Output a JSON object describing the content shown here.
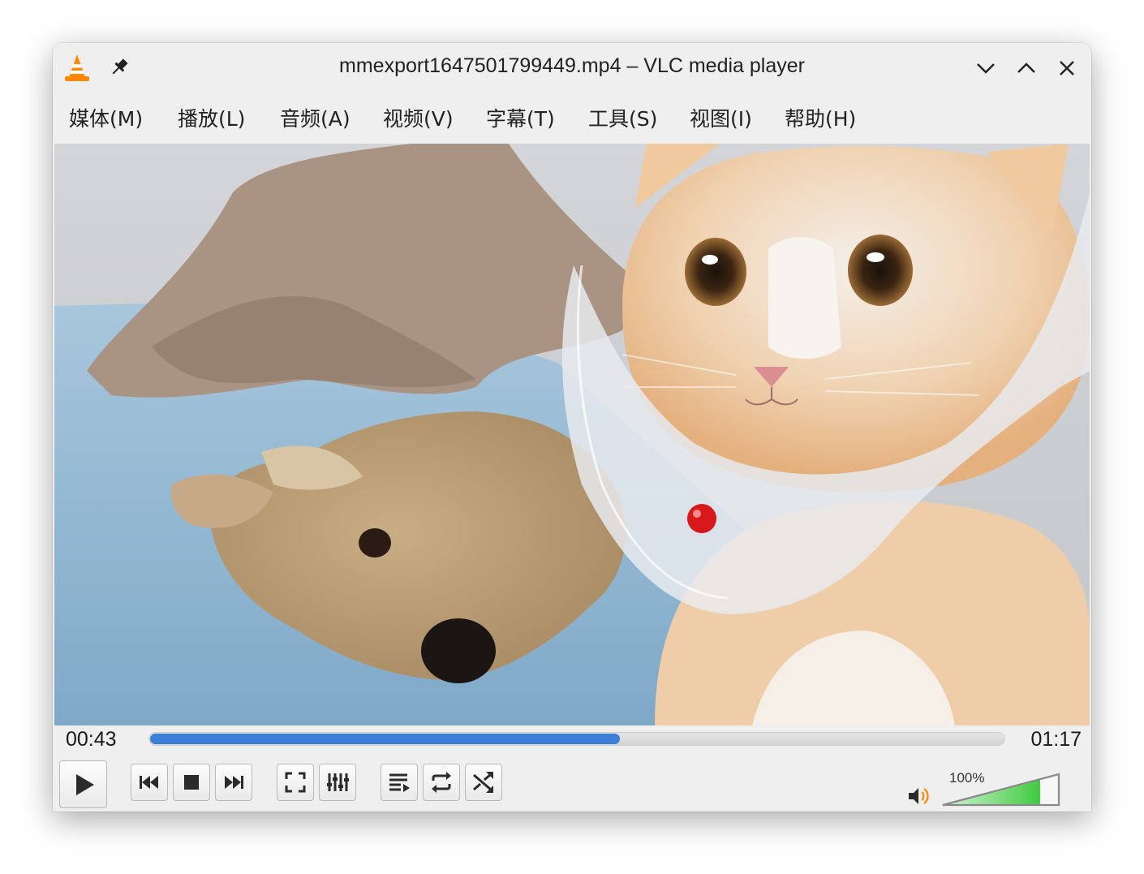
{
  "window": {
    "title": "mmexport1647501799449.mp4 – VLC media player"
  },
  "menu": {
    "items": [
      {
        "label": "媒体(M)"
      },
      {
        "label": "播放(L)"
      },
      {
        "label": "音频(A)"
      },
      {
        "label": "视频(V)"
      },
      {
        "label": "字幕(T)"
      },
      {
        "label": "工具(S)"
      },
      {
        "label": "视图(I)"
      },
      {
        "label": "帮助(H)"
      }
    ]
  },
  "playback": {
    "elapsed": "00:43",
    "total": "01:17",
    "progress_fraction": 0.55
  },
  "controls": {
    "icons": [
      "play-icon",
      "previous-icon",
      "stop-icon",
      "next-icon",
      "fullscreen-icon",
      "extended-settings-icon",
      "playlist-icon",
      "loop-icon",
      "shuffle-icon"
    ]
  },
  "volume": {
    "label": "100%",
    "level_fraction": 1.0
  },
  "colors": {
    "progress": "#3b7fd6",
    "volume": "#3fcb3f",
    "vlc_orange": "#ff8800"
  }
}
